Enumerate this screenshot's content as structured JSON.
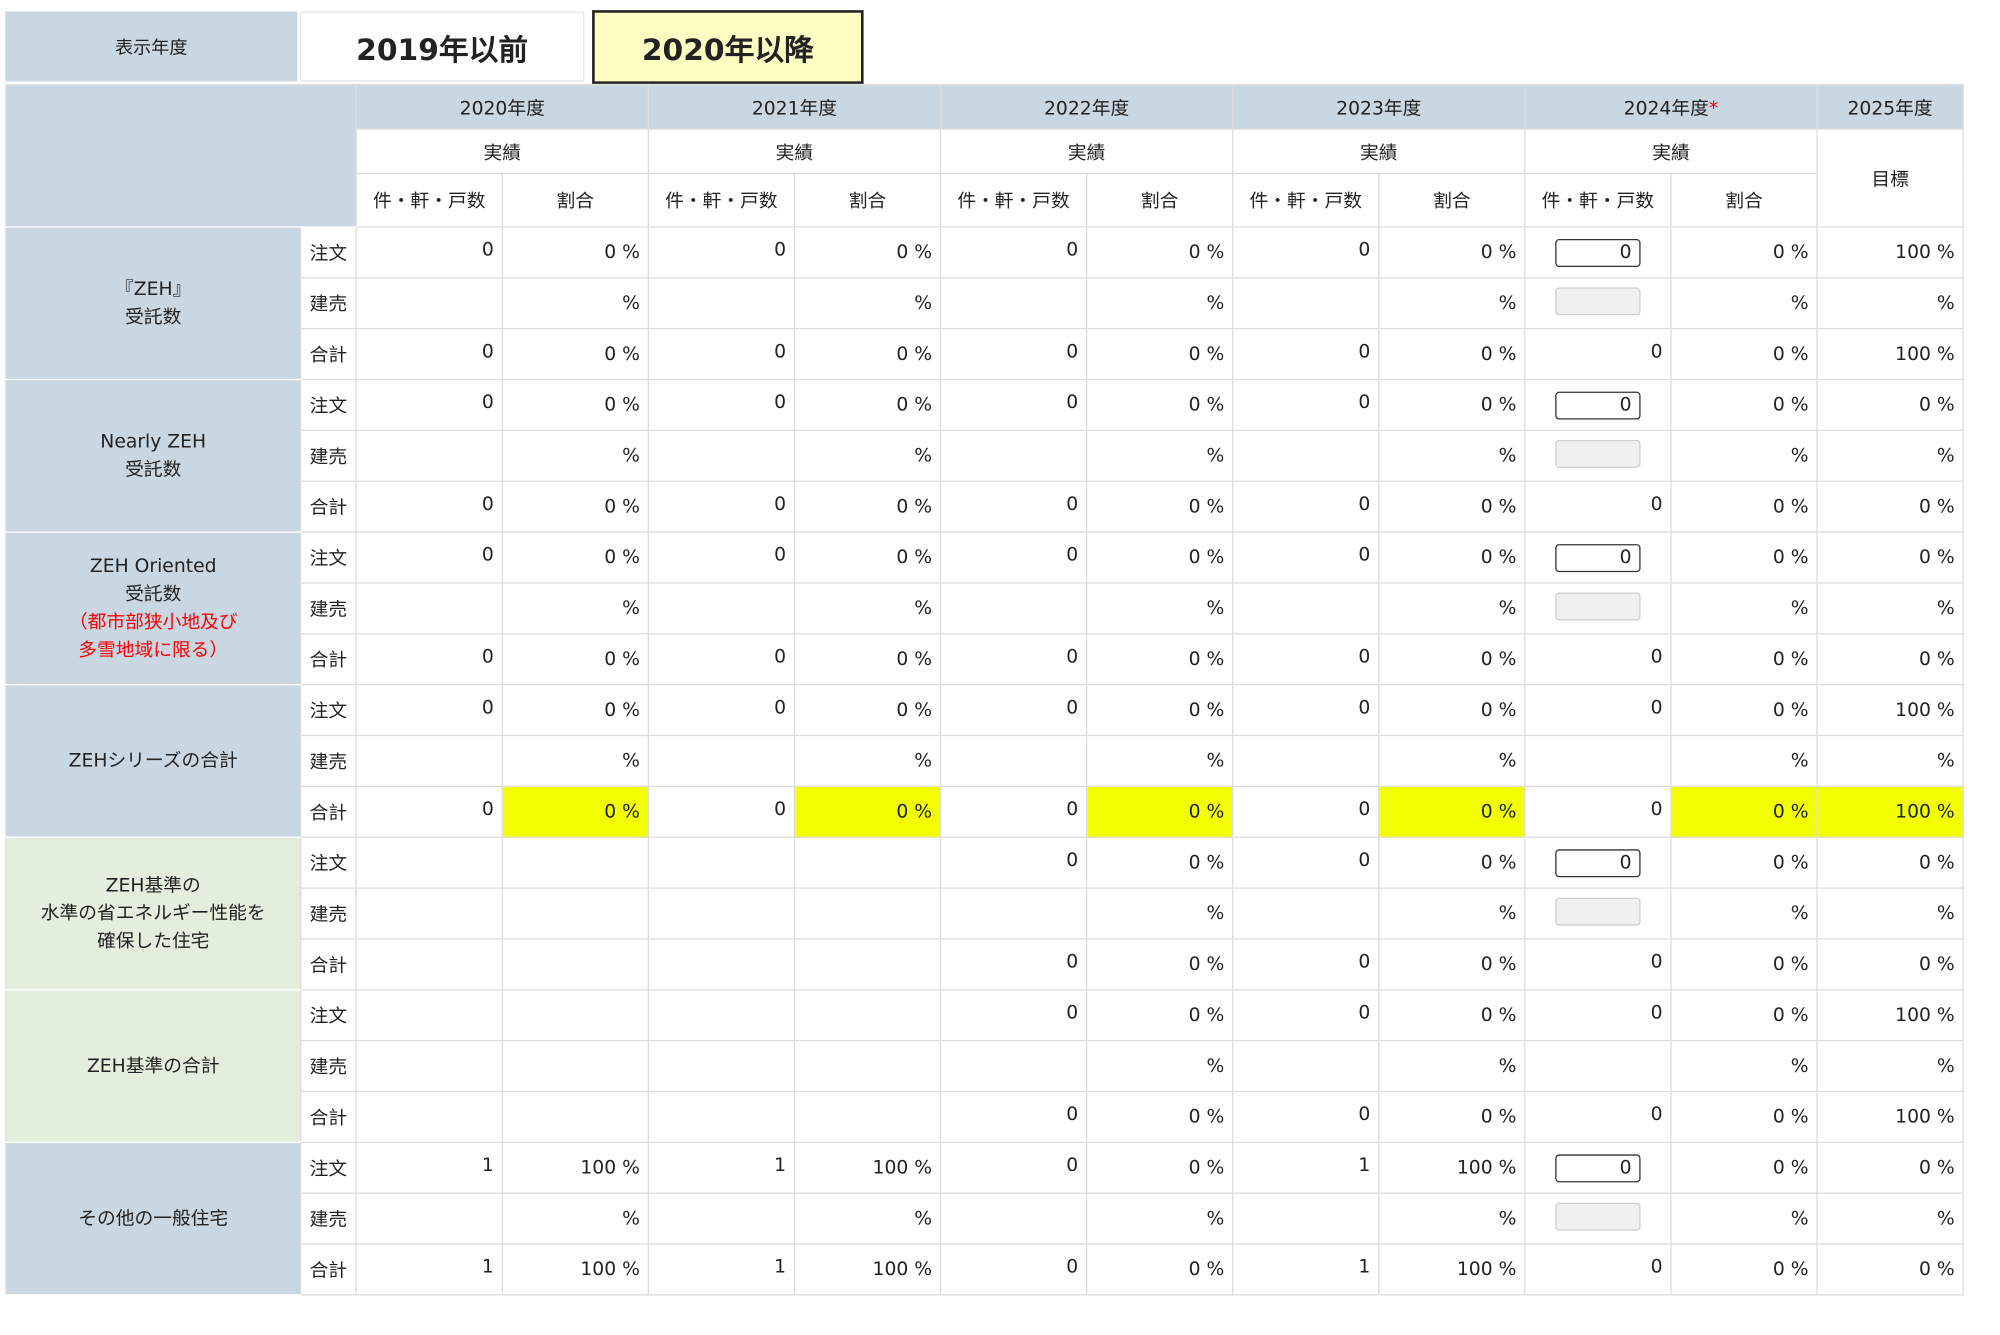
{
  "topbar": {
    "label": "表示年度",
    "btn_prev": "2019年以前",
    "btn_next": "2020年以降"
  },
  "header": {
    "years": [
      {
        "label": "2020年度",
        "star": ""
      },
      {
        "label": "2021年度",
        "star": ""
      },
      {
        "label": "2022年度",
        "star": ""
      },
      {
        "label": "2023年度",
        "star": ""
      },
      {
        "label": "2024年度",
        "star": "*"
      },
      {
        "label": "2025年度",
        "star": ""
      }
    ],
    "actual": "実績",
    "target": "目標",
    "count_col": "件・軒・戸数",
    "ratio_col": "割合"
  },
  "row_labels": [
    "注文",
    "建売",
    "合計"
  ],
  "categories": [
    {
      "lines": [
        "『ZEH』",
        "受託数"
      ],
      "red_lines": [],
      "color": "blue",
      "rows": [
        {
          "cells": [
            [
              "0",
              "0 %"
            ],
            [
              "0",
              "0 %"
            ],
            [
              "0",
              "0 %"
            ],
            [
              "0",
              "0 %"
            ]
          ],
          "c24": "0",
          "c24_type": "input",
          "p24": "0 %",
          "t": "100 %",
          "hl": false
        },
        {
          "cells": [
            [
              "",
              "%"
            ],
            [
              "",
              "%"
            ],
            [
              "",
              "%"
            ],
            [
              "",
              "%"
            ]
          ],
          "c24": "",
          "c24_type": "disabled",
          "p24": "%",
          "t": "%",
          "hl": false
        },
        {
          "cells": [
            [
              "0",
              "0 %"
            ],
            [
              "0",
              "0 %"
            ],
            [
              "0",
              "0 %"
            ],
            [
              "0",
              "0 %"
            ]
          ],
          "c24": "0",
          "c24_type": "text",
          "p24": "0 %",
          "t": "100 %",
          "hl": false
        }
      ]
    },
    {
      "lines": [
        "Nearly ZEH",
        "受託数"
      ],
      "red_lines": [],
      "color": "blue",
      "rows": [
        {
          "cells": [
            [
              "0",
              "0 %"
            ],
            [
              "0",
              "0 %"
            ],
            [
              "0",
              "0 %"
            ],
            [
              "0",
              "0 %"
            ]
          ],
          "c24": "0",
          "c24_type": "input",
          "p24": "0 %",
          "t": "0 %",
          "hl": false
        },
        {
          "cells": [
            [
              "",
              "%"
            ],
            [
              "",
              "%"
            ],
            [
              "",
              "%"
            ],
            [
              "",
              "%"
            ]
          ],
          "c24": "",
          "c24_type": "disabled",
          "p24": "%",
          "t": "%",
          "hl": false
        },
        {
          "cells": [
            [
              "0",
              "0 %"
            ],
            [
              "0",
              "0 %"
            ],
            [
              "0",
              "0 %"
            ],
            [
              "0",
              "0 %"
            ]
          ],
          "c24": "0",
          "c24_type": "text",
          "p24": "0 %",
          "t": "0 %",
          "hl": false
        }
      ]
    },
    {
      "lines": [
        "ZEH Oriented",
        "受託数"
      ],
      "red_lines": [
        "（都市部狭小地及び",
        "多雪地域に限る）"
      ],
      "color": "blue",
      "rows": [
        {
          "cells": [
            [
              "0",
              "0 %"
            ],
            [
              "0",
              "0 %"
            ],
            [
              "0",
              "0 %"
            ],
            [
              "0",
              "0 %"
            ]
          ],
          "c24": "0",
          "c24_type": "input",
          "p24": "0 %",
          "t": "0 %",
          "hl": false
        },
        {
          "cells": [
            [
              "",
              "%"
            ],
            [
              "",
              "%"
            ],
            [
              "",
              "%"
            ],
            [
              "",
              "%"
            ]
          ],
          "c24": "",
          "c24_type": "disabled",
          "p24": "%",
          "t": "%",
          "hl": false
        },
        {
          "cells": [
            [
              "0",
              "0 %"
            ],
            [
              "0",
              "0 %"
            ],
            [
              "0",
              "0 %"
            ],
            [
              "0",
              "0 %"
            ]
          ],
          "c24": "0",
          "c24_type": "text",
          "p24": "0 %",
          "t": "0 %",
          "hl": false
        }
      ]
    },
    {
      "lines": [
        "ZEHシリーズの合計"
      ],
      "red_lines": [],
      "color": "blue",
      "rows": [
        {
          "cells": [
            [
              "0",
              "0 %"
            ],
            [
              "0",
              "0 %"
            ],
            [
              "0",
              "0 %"
            ],
            [
              "0",
              "0 %"
            ]
          ],
          "c24": "0",
          "c24_type": "text",
          "p24": "0 %",
          "t": "100 %",
          "hl": false
        },
        {
          "cells": [
            [
              "",
              "%"
            ],
            [
              "",
              "%"
            ],
            [
              "",
              "%"
            ],
            [
              "",
              "%"
            ]
          ],
          "c24": "",
          "c24_type": "text",
          "p24": "%",
          "t": "%",
          "hl": false
        },
        {
          "cells": [
            [
              "0",
              "0 %"
            ],
            [
              "0",
              "0 %"
            ],
            [
              "0",
              "0 %"
            ],
            [
              "0",
              "0 %"
            ]
          ],
          "c24": "0",
          "c24_type": "text",
          "p24": "0 %",
          "t": "100 %",
          "hl": true
        }
      ]
    },
    {
      "lines": [
        "ZEH基準の",
        "水準の省エネルギー性能を",
        "確保した住宅"
      ],
      "red_lines": [],
      "color": "green",
      "rows": [
        {
          "cells": [
            [
              "",
              ""
            ],
            [
              "",
              ""
            ],
            [
              "0",
              "0 %"
            ],
            [
              "0",
              "0 %"
            ]
          ],
          "c24": "0",
          "c24_type": "input",
          "p24": "0 %",
          "t": "0 %",
          "hl": false
        },
        {
          "cells": [
            [
              "",
              ""
            ],
            [
              "",
              ""
            ],
            [
              "",
              "%"
            ],
            [
              "",
              "%"
            ]
          ],
          "c24": "",
          "c24_type": "disabled",
          "p24": "%",
          "t": "%",
          "hl": false
        },
        {
          "cells": [
            [
              "",
              ""
            ],
            [
              "",
              ""
            ],
            [
              "0",
              "0 %"
            ],
            [
              "0",
              "0 %"
            ]
          ],
          "c24": "0",
          "c24_type": "text",
          "p24": "0 %",
          "t": "0 %",
          "hl": false
        }
      ]
    },
    {
      "lines": [
        "ZEH基準の合計"
      ],
      "red_lines": [],
      "color": "green",
      "rows": [
        {
          "cells": [
            [
              "",
              ""
            ],
            [
              "",
              ""
            ],
            [
              "0",
              "0 %"
            ],
            [
              "0",
              "0 %"
            ]
          ],
          "c24": "0",
          "c24_type": "text",
          "p24": "0 %",
          "t": "100 %",
          "hl": false
        },
        {
          "cells": [
            [
              "",
              ""
            ],
            [
              "",
              ""
            ],
            [
              "",
              "%"
            ],
            [
              "",
              "%"
            ]
          ],
          "c24": "",
          "c24_type": "text",
          "p24": "%",
          "t": "%",
          "hl": false
        },
        {
          "cells": [
            [
              "",
              ""
            ],
            [
              "",
              ""
            ],
            [
              "0",
              "0 %"
            ],
            [
              "0",
              "0 %"
            ]
          ],
          "c24": "0",
          "c24_type": "text",
          "p24": "0 %",
          "t": "100 %",
          "hl": false
        }
      ]
    },
    {
      "lines": [
        "その他の一般住宅"
      ],
      "red_lines": [],
      "color": "blue",
      "rows": [
        {
          "cells": [
            [
              "1",
              "100 %"
            ],
            [
              "1",
              "100 %"
            ],
            [
              "0",
              "0 %"
            ],
            [
              "1",
              "100 %"
            ]
          ],
          "c24": "0",
          "c24_type": "input",
          "p24": "0 %",
          "t": "0 %",
          "hl": false
        },
        {
          "cells": [
            [
              "",
              "%"
            ],
            [
              "",
              "%"
            ],
            [
              "",
              "%"
            ],
            [
              "",
              "%"
            ]
          ],
          "c24": "",
          "c24_type": "disabled",
          "p24": "%",
          "t": "%",
          "hl": false
        },
        {
          "cells": [
            [
              "1",
              "100 %"
            ],
            [
              "1",
              "100 %"
            ],
            [
              "0",
              "0 %"
            ],
            [
              "1",
              "100 %"
            ]
          ],
          "c24": "0",
          "c24_type": "text",
          "p24": "0 %",
          "t": "0 %",
          "hl": false
        }
      ]
    }
  ]
}
